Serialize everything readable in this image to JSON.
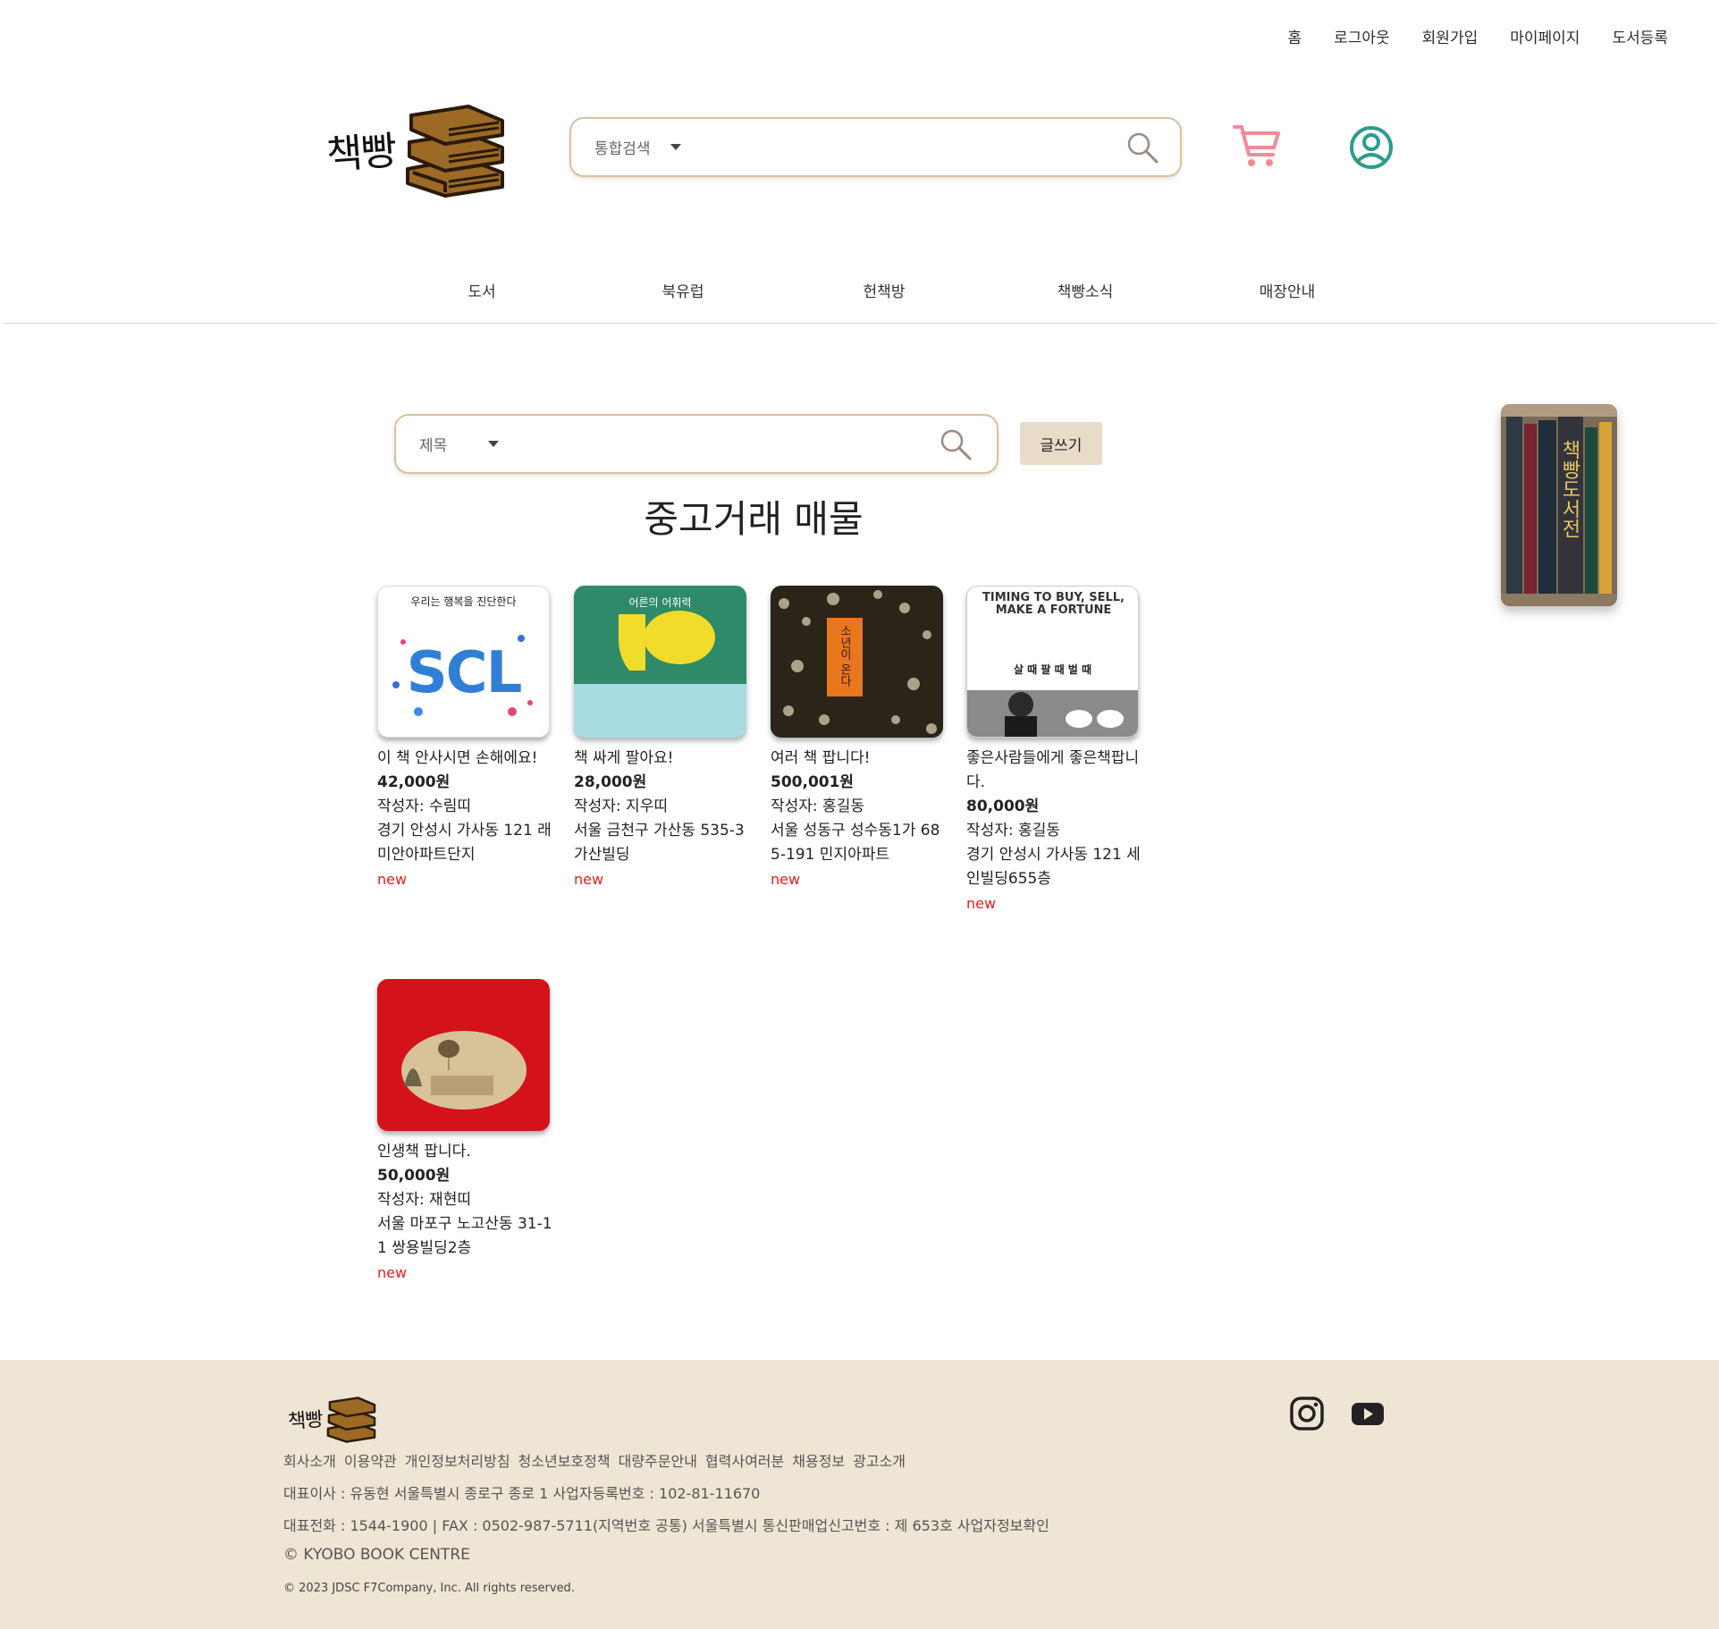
{
  "top_links": [
    "홈",
    "로그아웃",
    "회원가입",
    "마이페이지",
    "도서등록"
  ],
  "logo": {
    "text": "책빵"
  },
  "header_search": {
    "scope": "통합검색",
    "placeholder": ""
  },
  "main_nav": [
    "도서",
    "북유럽",
    "헌책방",
    "책빵소식",
    "매장안내"
  ],
  "board_search": {
    "scope": "제목",
    "placeholder": ""
  },
  "write_button": "글쓰기",
  "page_title": "중고거래 매물",
  "side_banner": {
    "text": "책빵도서전"
  },
  "listings": [
    {
      "title": "이 책 안사시면 손해에요!",
      "price": "42,000원",
      "writer": "작성자: 수림띠",
      "address": "경기 안성시 가사동 121 래미안아파트단지",
      "badge": "new",
      "cover": {
        "top_text": "우리는 행복을 진단한다",
        "big_text": "SCL"
      }
    },
    {
      "title": "책 싸게 팔아요!",
      "price": "28,000원",
      "writer": "작성자: 지우띠",
      "address": "서울 금천구 가산동 535-3 가산빌딩",
      "badge": "new",
      "cover": {
        "top_text": "어른의 어휘력"
      }
    },
    {
      "title": "여러 책 팝니다!",
      "price": "500,001원",
      "writer": "작성자: 홍길동",
      "address": "서울 성동구 성수동1가 685-191 민지아파트",
      "badge": "new",
      "cover": {
        "top_text": "소년이 온다"
      }
    },
    {
      "title": "좋은사람들에게 좋은책팝니다.",
      "price": "80,000원",
      "writer": "작성자: 홍길동",
      "address": "경기 안성시 가사동 121 세인빌딩655층",
      "badge": "new",
      "cover": {
        "top_text": "TIMING TO BUY, SELL, MAKE A FORTUNE",
        "sub_text": "살 때 팔 때 벌 때"
      }
    },
    {
      "title": "인생책 팝니다.",
      "price": "50,000원",
      "writer": "작성자: 재현띠",
      "address": "서울 마포구 노고산동 31-11 쌍용빌딩2층",
      "badge": "new",
      "cover": {}
    }
  ],
  "footer": {
    "logo_text": "책빵",
    "links": [
      "회사소개",
      "이용약관",
      "개인정보처리방침",
      "청소년보호정책",
      "대량주문안내",
      "협력사여러분",
      "채용정보",
      "광고소개"
    ],
    "line1": "대표이사 : 유동현 서울특별시 종로구 종로 1 사업자등록번호 : 102-81-11670",
    "line2": "대표전화 : 1544-1900 | FAX : 0502-987-5711(지역번호 공통) 서울특별시 통신판매업신고번호 : 제 653호 사업자정보확인",
    "line3": "© KYOBO BOOK CENTRE",
    "copyright": "© 2023 JDSC F7Company, Inc. All rights reserved."
  },
  "colors": {
    "accent": "#d8c29c",
    "button_bg": "#e8dcc9",
    "footer_bg": "#efe5d4",
    "cart": "#f28b95",
    "user": "#2a9d8f",
    "new_badge": "#e41e1e"
  }
}
